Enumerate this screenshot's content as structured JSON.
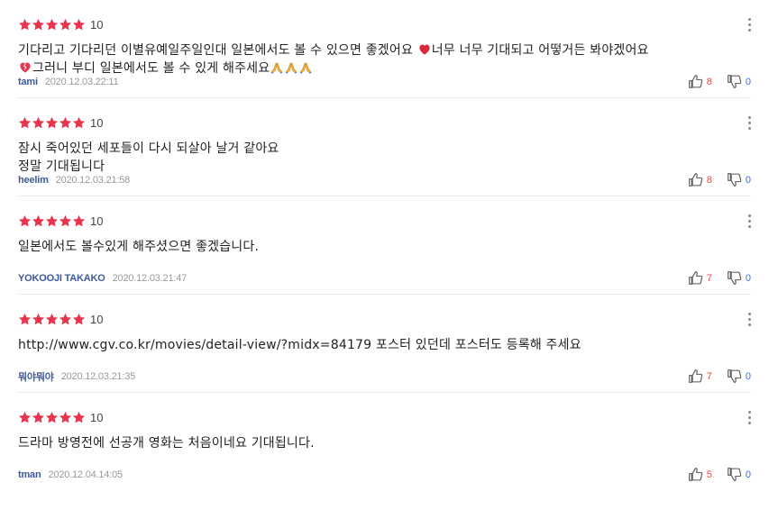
{
  "colors": {
    "star": "#e8344c",
    "author": "#3d5a99",
    "like": "#e84a4a",
    "dislike": "#3d6fd8"
  },
  "reviews": [
    {
      "score": "10",
      "lines": [
        [
          "기다리고 기다리던 이별유예일주일인대 일본에서도 볼 수 있으면 좋겠어요 ",
          "heart",
          "너무 너무 기대되고 어떻거든 봐야겠어요"
        ],
        [
          "broken-heart",
          "그러니 부디 일본에서도 볼 수 있게 해주세요",
          "pray",
          "pray",
          "pray"
        ]
      ],
      "author": "tami",
      "date": "2020.12.03.22:11",
      "likes": "8",
      "dislikes": "0"
    },
    {
      "score": "10",
      "lines": [
        [
          "잠시  죽어있던 세포들이 다시 되살아 날거 같아요"
        ],
        [
          "정말 기대됩니다"
        ]
      ],
      "author": "heelim",
      "date": "2020.12.03.21:58",
      "likes": "8",
      "dislikes": "0"
    },
    {
      "score": "10",
      "lines": [
        [
          "일본에서도 볼수있게 해주셨으면 좋겠습니다."
        ]
      ],
      "author": "YOKOOJI TAKAKO",
      "date": "2020.12.03.21:47",
      "likes": "7",
      "dislikes": "0"
    },
    {
      "score": "10",
      "lines": [
        [
          "http://www.cgv.co.kr/movies/detail-view/?midx=84179 포스터 있던데 포스터도 등록해 주세요"
        ]
      ],
      "author": "뭐야뭐야",
      "date": "2020.12.03.21:35",
      "likes": "7",
      "dislikes": "0"
    },
    {
      "score": "10",
      "lines": [
        [
          "드라마 방영전에 선공개 영화는 처음이네요 기대됩니다."
        ]
      ],
      "author": "tman",
      "date": "2020.12.04.14:05",
      "likes": "5",
      "dislikes": "0"
    }
  ]
}
